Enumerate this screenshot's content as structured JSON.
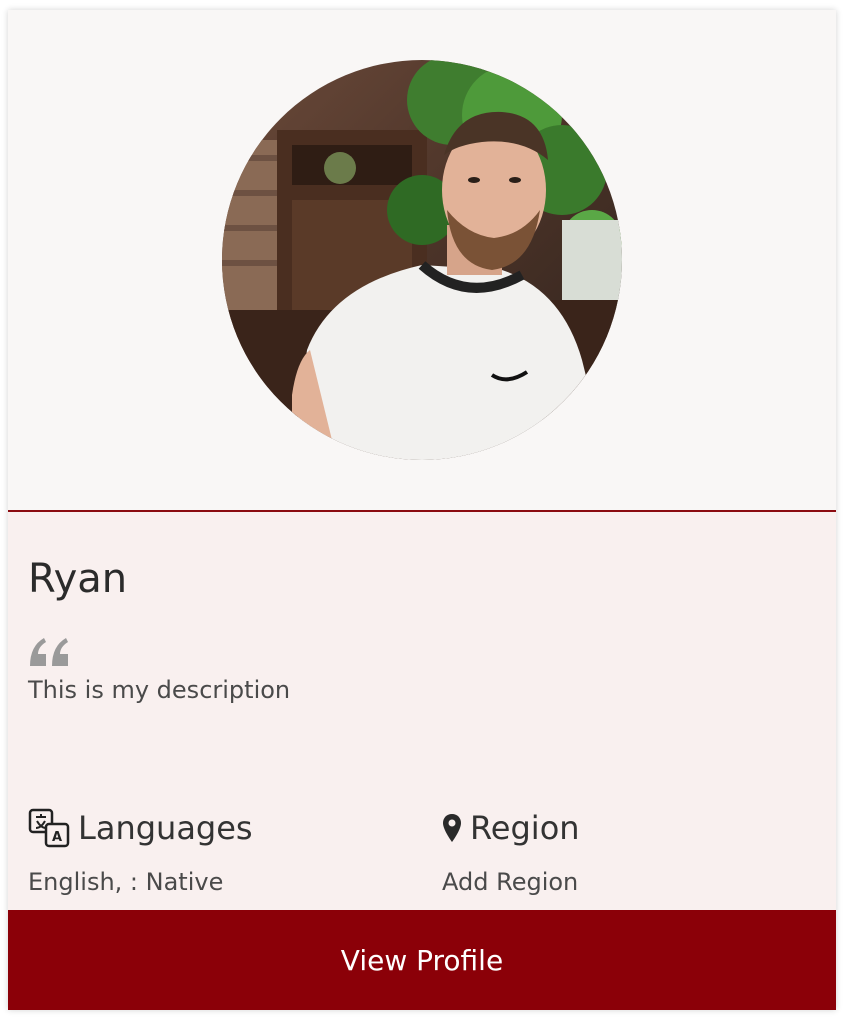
{
  "profile": {
    "name": "Ryan",
    "description": "This is my description"
  },
  "languages": {
    "title": "Languages",
    "value": "English, : Native"
  },
  "region": {
    "title": "Region",
    "value": "Add Region"
  },
  "actions": {
    "view_profile_label": "View Profile"
  },
  "icons": {
    "languages": "translate-icon",
    "region": "map-pin-icon",
    "quote": "quote-icon"
  },
  "colors": {
    "accent": "#8b0008",
    "divider": "#8b0b10",
    "card_top_bg": "#f9f7f6",
    "card_body_bg": "#f9f0ef"
  }
}
